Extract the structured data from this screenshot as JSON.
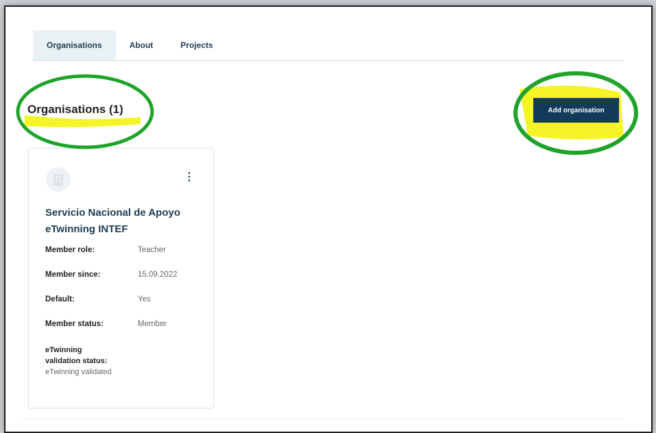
{
  "tabs": [
    {
      "label": "Organisations",
      "active": true
    },
    {
      "label": "About",
      "active": false
    },
    {
      "label": "Projects",
      "active": false
    }
  ],
  "heading": "Organisations (1)",
  "add_button": "Add organisation",
  "card": {
    "org_name": "Servicio Nacional de Apoyo eTwinning INTEF",
    "menu_icon": "kebab-menu-icon",
    "logo_icon": "building-icon",
    "fields": [
      {
        "label": "Member role:",
        "value": "Teacher"
      },
      {
        "label": "Member since:",
        "value": "15.09.2022"
      },
      {
        "label": "Default:",
        "value": "Yes"
      },
      {
        "label": "Member status:",
        "value": "Member"
      }
    ],
    "validation_label_1": "eTwinning",
    "validation_label_2": "validation status:",
    "validation_value": "eTwinning validated"
  },
  "colors": {
    "primary": "#123a59",
    "tab_active_bg": "#eaf1f5",
    "annotation_green": "#1fa32a",
    "annotation_yellow": "#f2f200"
  }
}
